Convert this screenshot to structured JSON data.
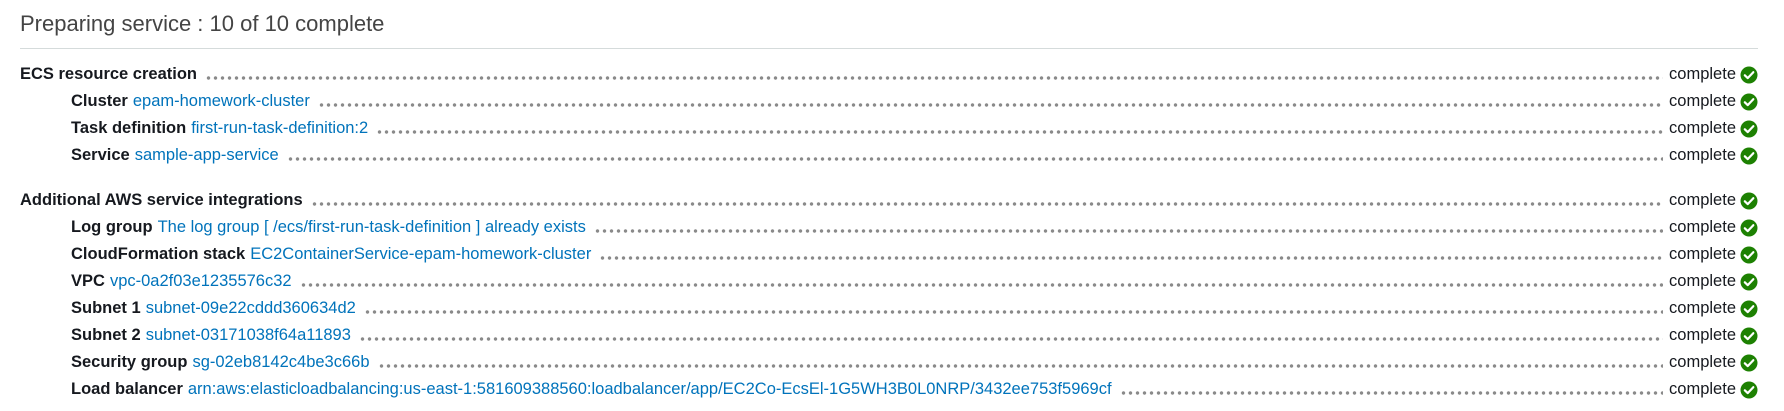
{
  "header": {
    "title": "Preparing service : 10 of 10 complete"
  },
  "colors": {
    "link": "#0073bb",
    "success": "#1d8102"
  },
  "sections": [
    {
      "label": "ECS resource creation",
      "status": "complete",
      "items": [
        {
          "label": "Cluster",
          "value": "epam-homework-cluster",
          "status": "complete"
        },
        {
          "label": "Task definition",
          "value": "first-run-task-definition:2",
          "status": "complete"
        },
        {
          "label": "Service",
          "value": "sample-app-service",
          "status": "complete"
        }
      ]
    },
    {
      "label": "Additional AWS service integrations",
      "status": "complete",
      "items": [
        {
          "label": "Log group",
          "value": "The log group [ /ecs/first-run-task-definition ] already exists",
          "status": "complete"
        },
        {
          "label": "CloudFormation stack",
          "value": "EC2ContainerService-epam-homework-cluster",
          "status": "complete"
        },
        {
          "label": "VPC",
          "value": "vpc-0a2f03e1235576c32",
          "status": "complete"
        },
        {
          "label": "Subnet 1",
          "value": "subnet-09e22cddd360634d2",
          "status": "complete"
        },
        {
          "label": "Subnet 2",
          "value": "subnet-03171038f64a11893",
          "status": "complete"
        },
        {
          "label": "Security group",
          "value": "sg-02eb8142c4be3c66b",
          "status": "complete"
        },
        {
          "label": "Load balancer",
          "value": "arn:aws:elasticloadbalancing:us-east-1:581609388560:loadbalancer/app/EC2Co-EcsEl-1G5WH3B0L0NRP/3432ee753f5969cf",
          "status": "complete"
        }
      ]
    }
  ],
  "icons": {
    "status": "check-circle-icon"
  }
}
